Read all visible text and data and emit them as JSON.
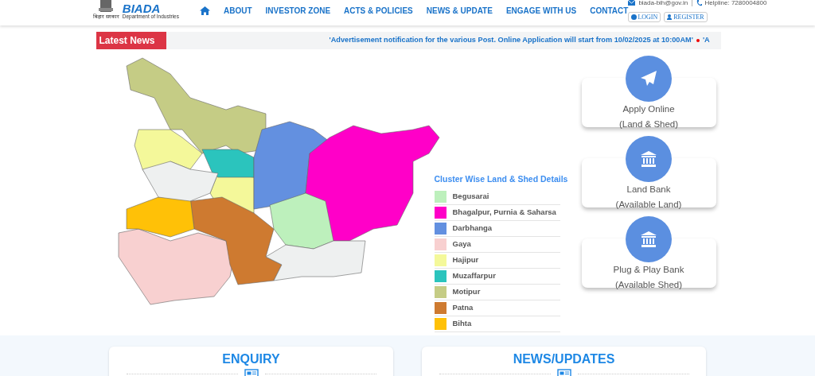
{
  "header": {
    "logo_text": "BIADA",
    "logo_subtitle": "Department of Industries",
    "emblem_caption": "बिहार सरकार",
    "nav": [
      {
        "kind": "home"
      },
      {
        "kind": "link",
        "label": "ABOUT"
      },
      {
        "kind": "link",
        "label": "INVESTOR ZONE"
      },
      {
        "kind": "link",
        "label": "ACTS & POLICIES"
      },
      {
        "kind": "link",
        "label": "NEWS & UPDATE"
      },
      {
        "kind": "link",
        "label": "ENGAGE WITH US"
      },
      {
        "kind": "link",
        "label": "CONTACT"
      }
    ],
    "email": "biada-bih@gov.in",
    "separator": "|",
    "helpline": "Helpline: 7280004800",
    "login": "LOGIN",
    "register": "REGISTER"
  },
  "news": {
    "label": "Latest News",
    "items": [
      "'Advertisement notification for the various Post. Online Application will start from 10/02/2025 at 10:00AM'",
      "'A"
    ]
  },
  "legend": {
    "title": "Cluster Wise Land & Shed Details",
    "items": [
      {
        "name": "Begusarai",
        "color": "#bdf0bc"
      },
      {
        "name": "Bhagalpur, Purnia & Saharsa",
        "color": "#ff00c8"
      },
      {
        "name": "Darbhanga",
        "color": "#6390e0"
      },
      {
        "name": "Gaya",
        "color": "#f8d0d0"
      },
      {
        "name": "Hajipur",
        "color": "#f4f89a"
      },
      {
        "name": "Muzaffarpur",
        "color": "#2bc4bd"
      },
      {
        "name": "Motipur",
        "color": "#c5cc85"
      },
      {
        "name": "Patna",
        "color": "#ce7a30"
      },
      {
        "name": "Bihta",
        "color": "#ffc107"
      }
    ]
  },
  "actions": [
    {
      "kind": "send",
      "line1": "Apply Online",
      "line2": "(Land & Shed)"
    },
    {
      "kind": "bank",
      "line1": "Land Bank",
      "line2": "(Available Land)"
    },
    {
      "kind": "bank",
      "line1": "Plug & Play Bank",
      "line2": "(Available Shed)"
    }
  ],
  "panels": [
    {
      "title": "ENQUIRY"
    },
    {
      "title": "NEWS/UPDATES"
    }
  ]
}
